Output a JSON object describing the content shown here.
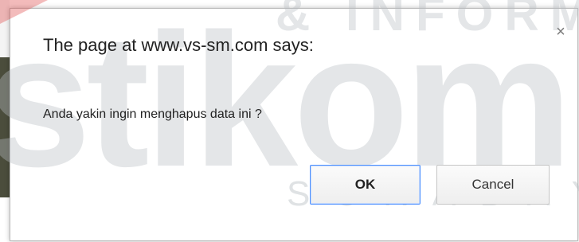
{
  "dialog": {
    "title": "The page at www.vs-sm.com says:",
    "message": "Anda yakin ingin menghapus data ini ?",
    "close_glyph": "×",
    "ok_label": "OK",
    "cancel_label": "Cancel"
  },
  "watermark": {
    "main": "stikom",
    "top": "& INFORMA",
    "bottom": "SURABAYA"
  },
  "colors": {
    "focus_border": "#4d90fe",
    "text": "#222222"
  }
}
